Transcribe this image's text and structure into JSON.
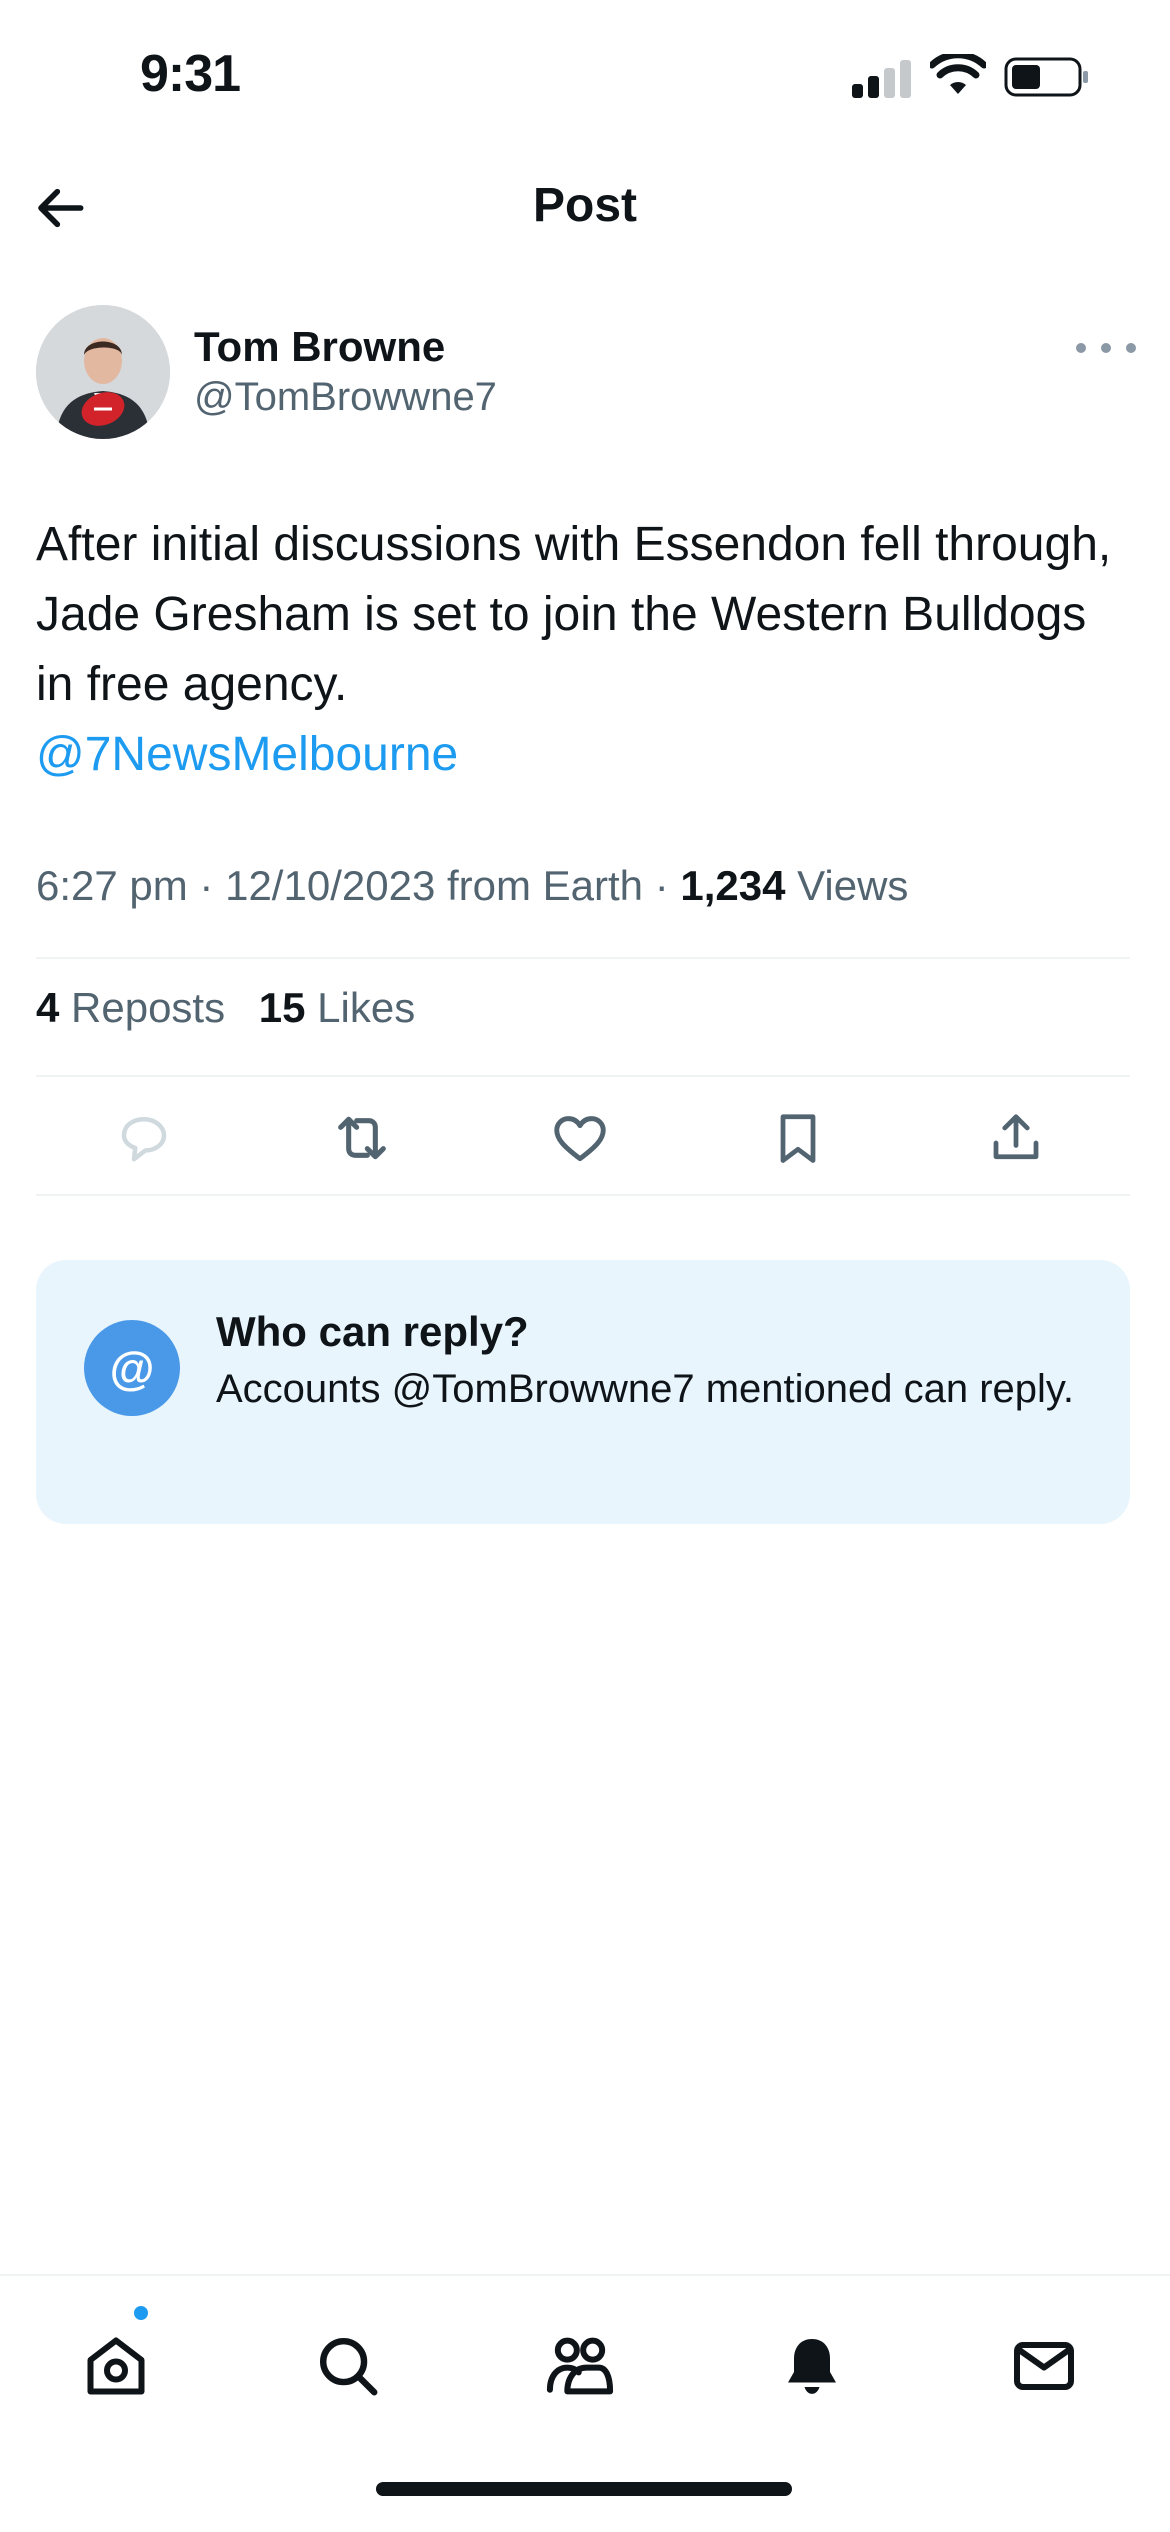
{
  "status_bar": {
    "time": "9:31"
  },
  "header": {
    "title": "Post",
    "back_icon": "arrow-left-icon"
  },
  "author": {
    "name": "Tom Browne",
    "handle": "@TomBrowwne7"
  },
  "tweet": {
    "text": "After initial discussions with Essendon fell through, Jade Gresham is set to join the Western Bulldogs in free agency.",
    "mention": "@7NewsMelbourne"
  },
  "meta": {
    "time": "6:27 pm",
    "sep1": " · ",
    "date": "12/10/2023",
    "source": " from Earth",
    "sep2": " · ",
    "views_count": "1,234",
    "views_label": " Views"
  },
  "stats": {
    "reposts_count": "4",
    "reposts_label": " Reposts",
    "likes_count": "15",
    "likes_label": " Likes"
  },
  "who_can_reply": {
    "badge": "@",
    "title": "Who can reply?",
    "description": "Accounts @TomBrowwne7 mentioned can reply."
  },
  "colors": {
    "accent": "#1d9bf0",
    "text": "#0f1419",
    "secondary_text": "#536471",
    "card_bg": "#e8f5fd",
    "badge_bg": "#4a99e9"
  },
  "icons": {
    "reply": "reply-icon",
    "repost": "repost-icon",
    "like": "heart-icon",
    "bookmark": "bookmark-icon",
    "share": "share-icon",
    "nav": [
      "home-icon",
      "search-icon",
      "communities-icon",
      "notifications-icon",
      "messages-icon"
    ]
  }
}
